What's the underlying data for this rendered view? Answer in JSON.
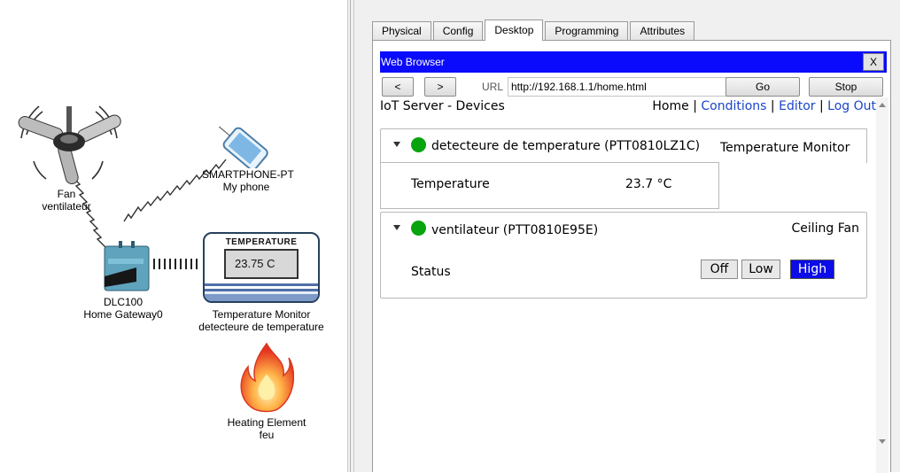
{
  "workspace": {
    "devices": [
      {
        "id": "fan",
        "type_label": "Fan",
        "name": "ventilateur",
        "icon": "ceiling-fan-icon"
      },
      {
        "id": "phone",
        "type_label": "SMARTPHONE-PT",
        "name": "My phone",
        "icon": "smartphone-icon"
      },
      {
        "id": "gateway",
        "type_label": "DLC100",
        "name": "Home Gateway0",
        "icon": "home-gateway-icon"
      },
      {
        "id": "monitor",
        "type_label": "Temperature Monitor",
        "name": "detecteure de temperature",
        "icon": "temperature-monitor-icon",
        "screen_title": "TEMPERATURE",
        "reading": "23.75 C"
      },
      {
        "id": "heater",
        "type_label": "Heating Element",
        "name": "feu",
        "icon": "fire-icon"
      }
    ]
  },
  "tabs": [
    "Physical",
    "Config",
    "Desktop",
    "Programming",
    "Attributes"
  ],
  "active_tab": "Desktop",
  "browser": {
    "title": "Web Browser",
    "close_label": "X",
    "back_label": "<",
    "forward_label": ">",
    "url_label": "URL",
    "url": "http://192.168.1.1/home.html",
    "go_label": "Go",
    "stop_label": "Stop"
  },
  "page": {
    "title": "IoT Server - Devices",
    "nav": {
      "home": "Home",
      "sep": "|",
      "conditions": "Conditions",
      "editor": "Editor",
      "logout": "Log Out"
    },
    "devices": [
      {
        "name": "detecteure de temperature (PTT0810LZ1C)",
        "type": "Temperature Monitor",
        "status_color": "#07a40e",
        "property": "Temperature",
        "value": "23.7 °C"
      },
      {
        "name": "ventilateur (PTT0810E95E)",
        "type": "Ceiling Fan",
        "status_color": "#07a40e",
        "property": "Status",
        "buttons": [
          "Off",
          "Low",
          "High"
        ],
        "selected": "High"
      }
    ]
  },
  "colors": {
    "title_bar": "#0a0afc",
    "link": "#1a45c9",
    "active_button": "#0c0ce6",
    "status_on": "#07a40e"
  }
}
